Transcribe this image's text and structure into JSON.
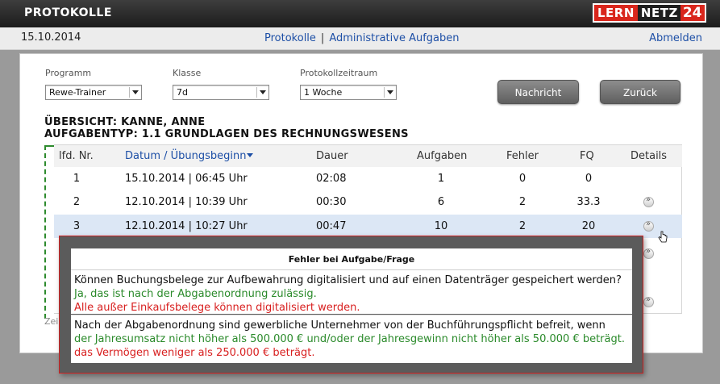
{
  "header": {
    "title": "PROTOKOLLE"
  },
  "logo": {
    "part1": "LERN",
    "part2": "NETZ",
    "part3": "24"
  },
  "nav": {
    "date": "15.10.2014",
    "link_protokolle": "Protokolle",
    "separator": "|",
    "link_admin": "Administrative Aufgaben",
    "logout": "Abmelden"
  },
  "filters": {
    "programm_label": "Programm",
    "programm_value": "Rewe-Trainer",
    "klasse_label": "Klasse",
    "klasse_value": "7d",
    "zeitraum_label": "Protokollzeitraum",
    "zeitraum_value": "1 Woche"
  },
  "buttons": {
    "nachricht": "Nachricht",
    "zurueck": "Zurück"
  },
  "overview": {
    "title": "ÜBERSICHT: KANNE, ANNE",
    "task_type": "AUFGABENTYP: 1.1 GRUNDLAGEN DES RECHNUNGSWESENS"
  },
  "table": {
    "headers": [
      "lfd. Nr.",
      "Datum / Übungsbeginn",
      "Dauer",
      "Aufgaben",
      "Fehler",
      "FQ",
      "Details"
    ],
    "rows": [
      {
        "nr": "1",
        "datum": "15.10.2014 | 06:45 Uhr",
        "dauer": "02:08",
        "aufgaben": "1",
        "fehler": "0",
        "fq": "0",
        "details": false
      },
      {
        "nr": "2",
        "datum": "12.10.2014 | 10:39 Uhr",
        "dauer": "00:30",
        "aufgaben": "6",
        "fehler": "2",
        "fq": "33.3",
        "details": true
      },
      {
        "nr": "3",
        "datum": "12.10.2014 | 10:27 Uhr",
        "dauer": "00:47",
        "aufgaben": "10",
        "fehler": "2",
        "fq": "20",
        "details": true
      }
    ]
  },
  "footer_partial": "Zei",
  "popup": {
    "title": "Fehler bei Aufgabe/Frage",
    "items": [
      {
        "question": "Können Buchungsbelege zur Aufbewahrung digitalisiert und auf einen Datenträger gespeichert werden?",
        "correct": "Ja, das ist nach der Abgabenordnung zulässig.",
        "wrong": "Alle außer Einkaufsbelege können digitalisiert werden."
      },
      {
        "question": "Nach der Abgabenordnung sind gewerbliche Unternehmer von der Buchführungspflicht befreit, wenn",
        "correct": "der Jahresumsatz nicht höher als 500.000 € und/oder der Jahresgewinn nicht höher als 50.000 € beträgt.",
        "wrong": "das Vermögen weniger als 250.000 € beträgt."
      }
    ]
  },
  "colors": {
    "correct": "#2a8a2a",
    "wrong": "#d82020",
    "link": "#1d4fa6",
    "highlight_row": "#dce7f5"
  }
}
